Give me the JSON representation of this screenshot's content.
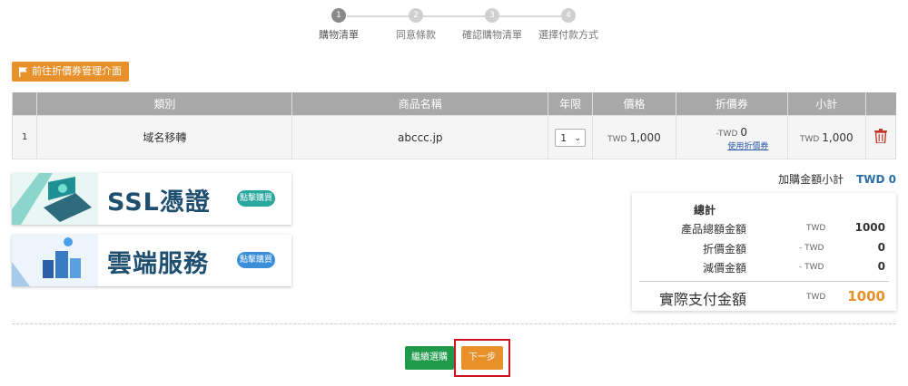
{
  "stepper": {
    "steps": [
      {
        "num": "1",
        "label": "購物清單"
      },
      {
        "num": "2",
        "label": "同意條款"
      },
      {
        "num": "3",
        "label": "確認購物清單"
      },
      {
        "num": "4",
        "label": "選擇付款方式"
      }
    ]
  },
  "coupon_button": {
    "label": "前往折價券管理介面"
  },
  "table": {
    "headers": [
      "類別",
      "商品名稱",
      "年限",
      "價格",
      "折價券",
      "小計"
    ],
    "rows": [
      {
        "index": "1",
        "category": "域名移轉",
        "product": "abccc.jp",
        "years": "1",
        "price_currency": "TWD",
        "price": "1,000",
        "discount_prefix": "-TWD",
        "discount": "0",
        "use_coupon": "使用折價券",
        "subtotal_currency": "TWD",
        "subtotal": "1,000"
      }
    ]
  },
  "banners": [
    {
      "title": "SSL憑證",
      "cta": "點擊購買"
    },
    {
      "title": "雲端服務",
      "cta": "點擊購買"
    }
  ],
  "addon_subtotal": {
    "label": "加購金額小計",
    "value": "TWD 0"
  },
  "summary": {
    "header": "總計",
    "rows": [
      {
        "label": "產品總額金額",
        "currency": "TWD",
        "value": "1000"
      },
      {
        "label": "折價金額",
        "currency": "- TWD",
        "value": "0"
      },
      {
        "label": "減價金額",
        "currency": "- TWD",
        "value": "0"
      }
    ],
    "total": {
      "label": "實際支付金額",
      "currency": "TWD",
      "value": "1000"
    }
  },
  "buttons": {
    "continue": "繼續選購",
    "next": "下一步"
  },
  "colors": {
    "accent_orange": "#e8902a",
    "continue_green": "#1f9a4a",
    "highlight_red": "#d0141c",
    "link_blue": "#2b6ea8"
  }
}
